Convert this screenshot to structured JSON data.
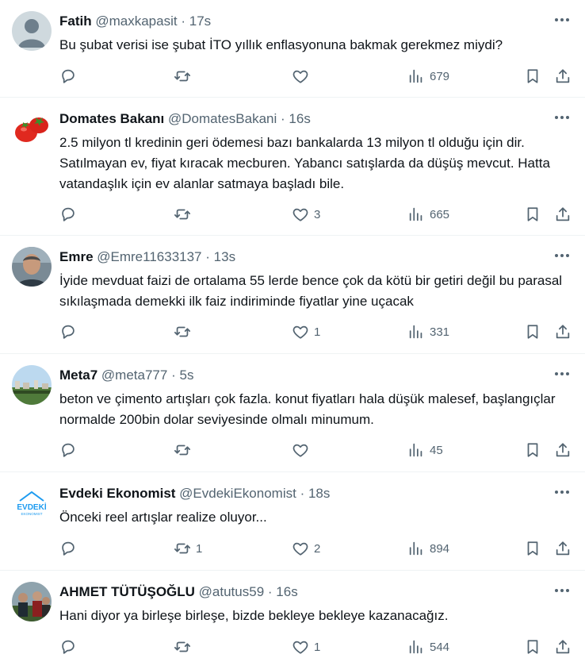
{
  "tweets": [
    {
      "name": "Fatih",
      "handle": "@maxkapasit",
      "time": "17s",
      "text": "Bu şubat verisi ise şubat İTO yıllık enflasyonuna bakmak gerekmez miydi?",
      "replies": "",
      "retweets": "",
      "likes": "",
      "views": "679",
      "avatar": "default-avatar-icon"
    },
    {
      "name": "Domates Bakanı",
      "handle": "@DomatesBakani",
      "time": "16s",
      "text": "2.5 milyon tl kredinin geri ödemesi bazı bankalarda 13 milyon tl olduğu için dir. Satılmayan ev, fiyat kıracak mecburen. Yabancı satışlarda da düşüş mevcut. Hatta vatandaşlık için ev alanlar satmaya başladı bile.",
      "replies": "",
      "retweets": "",
      "likes": "3",
      "views": "665",
      "avatar": "tomato-avatar"
    },
    {
      "name": "Emre",
      "handle": "@Emre11633137",
      "time": "13s",
      "text": "İyide mevduat faizi de ortalama 55 lerde bence çok da kötü bir getiri değil bu parasal sıkılaşmada demekki ilk faiz indiriminde fiyatlar yine uçacak",
      "replies": "",
      "retweets": "",
      "likes": "1",
      "views": "331",
      "avatar": "person-avatar"
    },
    {
      "name": "Meta7",
      "handle": "@meta777",
      "time": "5s",
      "text": "beton ve çimento artışları çok fazla. konut fiyatları hala düşük malesef, başlangıçlar normalde 200bin dolar seviyesinde olmalı minumum.",
      "replies": "",
      "retweets": "",
      "likes": "",
      "views": "45",
      "avatar": "landscape-avatar"
    },
    {
      "name": "Evdeki Ekonomist",
      "handle": "@EvdekiEkonomist",
      "time": "18s",
      "text": "Önceki reel artışlar realize oluyor...",
      "replies": "",
      "retweets": "1",
      "likes": "2",
      "views": "894",
      "avatar": "evdeki-logo-avatar",
      "avatar_text": "EVDEKİ",
      "avatar_subtext": "EKONOMIST"
    },
    {
      "name": "AHMET TÜTÜŞOĞLU",
      "handle": "@atutus59",
      "time": "16s",
      "text": "Hani diyor ya birleşe birleşe, bizde bekleye bekleye kazanacağız.",
      "replies": "",
      "retweets": "",
      "likes": "1",
      "views": "544",
      "avatar": "group-photo-avatar"
    }
  ],
  "colors": {
    "text": "#0f1419",
    "secondary": "#536471",
    "border": "#eff3f4",
    "brand_blue": "#1d9bf0"
  }
}
